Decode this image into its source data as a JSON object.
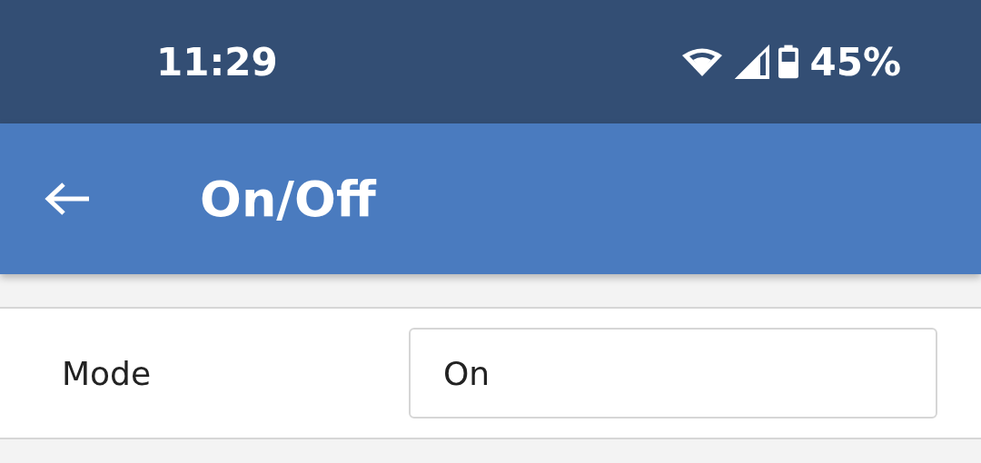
{
  "status_bar": {
    "time": "11:29",
    "battery": "45%"
  },
  "app_bar": {
    "title": "On/Off"
  },
  "fields": [
    {
      "label": "Mode",
      "value": "On"
    }
  ]
}
